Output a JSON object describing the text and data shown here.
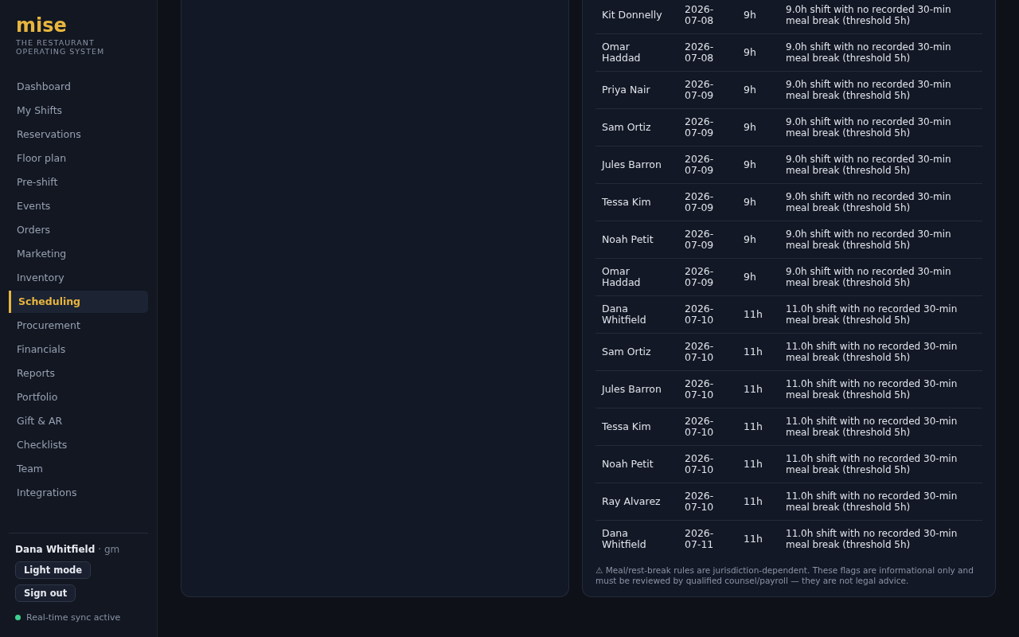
{
  "brand": {
    "name": "mise",
    "tagline": "THE RESTAURANT OPERATING SYSTEM"
  },
  "nav": [
    {
      "label": "Dashboard",
      "selected": false
    },
    {
      "label": "My Shifts",
      "selected": false
    },
    {
      "label": "Reservations",
      "selected": false
    },
    {
      "label": "Floor plan",
      "selected": false
    },
    {
      "label": "Pre-shift",
      "selected": false
    },
    {
      "label": "Events",
      "selected": false
    },
    {
      "label": "Orders",
      "selected": false
    },
    {
      "label": "Marketing",
      "selected": false
    },
    {
      "label": "Inventory",
      "selected": false
    },
    {
      "label": "Scheduling",
      "selected": true
    },
    {
      "label": "Procurement",
      "selected": false
    },
    {
      "label": "Financials",
      "selected": false
    },
    {
      "label": "Reports",
      "selected": false
    },
    {
      "label": "Portfolio",
      "selected": false
    },
    {
      "label": "Gift & AR",
      "selected": false
    },
    {
      "label": "Checklists",
      "selected": false
    },
    {
      "label": "Team",
      "selected": false
    },
    {
      "label": "Integrations",
      "selected": false
    }
  ],
  "user": {
    "name": "Dana Whitfield",
    "role": "· gm",
    "buttons": [
      "Light mode",
      "Sign out"
    ],
    "sync": {
      "label": "Real-time sync active",
      "on": true
    }
  },
  "flags_table": {
    "rows": [
      {
        "name": "Kit Donnelly",
        "date": "2026-07-08",
        "hours": "9h",
        "note": "9.0h shift with no recorded 30-min meal break (threshold 5h)"
      },
      {
        "name": "Omar Haddad",
        "date": "2026-07-08",
        "hours": "9h",
        "note": "9.0h shift with no recorded 30-min meal break (threshold 5h)"
      },
      {
        "name": "Priya Nair",
        "date": "2026-07-09",
        "hours": "9h",
        "note": "9.0h shift with no recorded 30-min meal break (threshold 5h)"
      },
      {
        "name": "Sam Ortiz",
        "date": "2026-07-09",
        "hours": "9h",
        "note": "9.0h shift with no recorded 30-min meal break (threshold 5h)"
      },
      {
        "name": "Jules Barron",
        "date": "2026-07-09",
        "hours": "9h",
        "note": "9.0h shift with no recorded 30-min meal break (threshold 5h)"
      },
      {
        "name": "Tessa Kim",
        "date": "2026-07-09",
        "hours": "9h",
        "note": "9.0h shift with no recorded 30-min meal break (threshold 5h)"
      },
      {
        "name": "Noah Petit",
        "date": "2026-07-09",
        "hours": "9h",
        "note": "9.0h shift with no recorded 30-min meal break (threshold 5h)"
      },
      {
        "name": "Omar Haddad",
        "date": "2026-07-09",
        "hours": "9h",
        "note": "9.0h shift with no recorded 30-min meal break (threshold 5h)"
      },
      {
        "name": "Dana Whitfield",
        "date": "2026-07-10",
        "hours": "11h",
        "note": "11.0h shift with no recorded 30-min meal break (threshold 5h)"
      },
      {
        "name": "Sam Ortiz",
        "date": "2026-07-10",
        "hours": "11h",
        "note": "11.0h shift with no recorded 30-min meal break (threshold 5h)"
      },
      {
        "name": "Jules Barron",
        "date": "2026-07-10",
        "hours": "11h",
        "note": "11.0h shift with no recorded 30-min meal break (threshold 5h)"
      },
      {
        "name": "Tessa Kim",
        "date": "2026-07-10",
        "hours": "11h",
        "note": "11.0h shift with no recorded 30-min meal break (threshold 5h)"
      },
      {
        "name": "Noah Petit",
        "date": "2026-07-10",
        "hours": "11h",
        "note": "11.0h shift with no recorded 30-min meal break (threshold 5h)"
      },
      {
        "name": "Ray Alvarez",
        "date": "2026-07-10",
        "hours": "11h",
        "note": "11.0h shift with no recorded 30-min meal break (threshold 5h)"
      },
      {
        "name": "Dana Whitfield",
        "date": "2026-07-11",
        "hours": "11h",
        "note": "11.0h shift with no recorded 30-min meal break (threshold 5h)"
      }
    ],
    "disclaimer": "⚠ Meal/rest-break rules are jurisdiction-dependent. These flags are informational only and must be reviewed by qualified counsel/payroll — they are not legal advice."
  }
}
